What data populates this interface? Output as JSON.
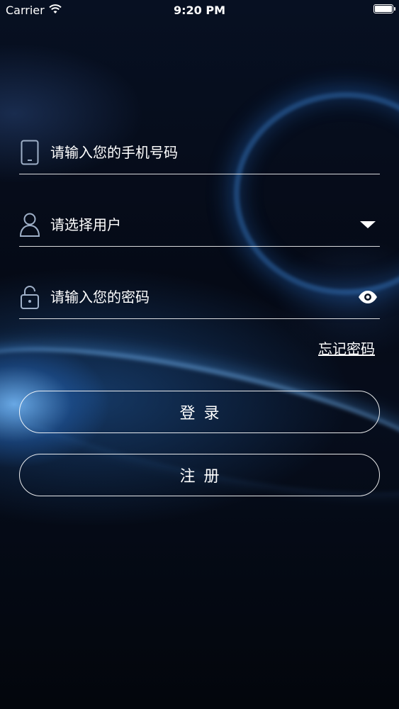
{
  "status_bar": {
    "carrier": "Carrier",
    "time": "9:20 PM",
    "wifi_icon": "wifi-icon",
    "battery_icon": "battery-icon"
  },
  "form": {
    "phone": {
      "placeholder": "请输入您的手机号码",
      "value": "",
      "icon": "phone-icon"
    },
    "user": {
      "placeholder": "请选择用户",
      "value": "",
      "icon": "user-icon",
      "right_icon": "dropdown-triangle-icon"
    },
    "password": {
      "placeholder": "请输入您的密码",
      "value": "",
      "icon": "lock-icon",
      "right_icon": "eye-icon"
    },
    "forgot_label": "忘记密码"
  },
  "actions": {
    "login_label": "登录",
    "register_label": "注册"
  }
}
